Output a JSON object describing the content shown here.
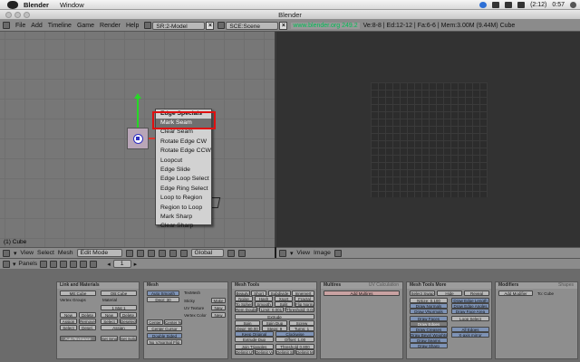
{
  "mac_menubar": {
    "app_name": "Blender",
    "menu": [
      "Window"
    ],
    "battery": "(2:12)",
    "clock": "0:57"
  },
  "window": {
    "title": "Blender"
  },
  "info_header": {
    "menus": [
      "File",
      "Add",
      "Timeline",
      "Game",
      "Render",
      "Help"
    ],
    "screen": "SR:2-Model",
    "scene": "SCE:Scene",
    "url": "www.blender.org 249.2",
    "stats": "Ve:8-8 | Ed:12-12 | Fa:6-6 | Mem:3.00M (9.44M) Cube"
  },
  "viewport_3d": {
    "object_label": "(1) Cube",
    "header": {
      "menus": [
        "View",
        "Select",
        "Mesh"
      ],
      "mode": "Edit Mode",
      "orientation": "Global"
    }
  },
  "edge_menu": {
    "title": "Edge Specials",
    "items": [
      "Mark Seam",
      "Clear Seam",
      "Rotate Edge CW",
      "Rotate Edge CCW",
      "Loopcut",
      "Edge Slide",
      "Edge Loop Select",
      "Edge Ring Select",
      "Loop to Region",
      "Region to Loop",
      "Mark Sharp",
      "Clear Sharp"
    ],
    "highlighted": "Mark Seam"
  },
  "image_editor": {
    "header": {
      "menus": [
        "View",
        "Image"
      ]
    }
  },
  "buttons_window": {
    "header_label": "Panels",
    "frame": "1",
    "panels": {
      "link_materials": {
        "title": "Link and Materials",
        "me": "ME:Cube",
        "ob": "OB:Cube",
        "vertex_groups": "Vertex Groups",
        "material": "Material",
        "mat_index": "1 Mat 1",
        "buttons": [
          "New",
          "Delete",
          "New",
          "Delete",
          "Assign",
          "Remove",
          "Select",
          "Deselect",
          "Select",
          "Desel.",
          "Assign",
          "AutoTexSpace",
          "Set Smooth",
          "Set Solid"
        ]
      },
      "mesh": {
        "title": "Mesh",
        "buttons": [
          "Auto Smooth",
          "Degr: 30",
          "TexMesh",
          "Sticky",
          "Make",
          "UV Texture",
          "New",
          "Vertex Color",
          "New",
          "Center",
          "Center New",
          "Center Cursor",
          "Double Sided",
          "No V.Normal Flip"
        ]
      },
      "mesh_tools": {
        "title": "Mesh Tools",
        "buttons": [
          "Beauty",
          "Short",
          "Subdivide",
          "Innervert",
          "Noise",
          "Hash",
          "Xsort",
          "Fractal",
          "To Sphere",
          "Smooth",
          "Split",
          "Flip Normals",
          "Rem Doubles",
          "Limit: 0.001",
          "Threshold: 0.010",
          "Extrude",
          "Spin",
          "Spin Dup",
          "Screw",
          "Degr: 90.00",
          "Steps: 9",
          "Turns: 1",
          "Keep Original",
          "Clockwise",
          "Extrude Dup",
          "Offset: 1.00",
          "Join Triangles",
          "Threshold 0.800",
          "Delimit UVs",
          "Delimit Vcol",
          "Delimit Sharp",
          "Delimit Mat"
        ]
      },
      "multires": {
        "title": "Multires",
        "tab": "UV Calculation",
        "button": "Add Multires"
      },
      "mesh_tools_more": {
        "title": "Mesh Tools More",
        "buttons": [
          "Select Swap",
          "Hide",
          "Reveal",
          "NSize: 0.100",
          "Draw Normals",
          "Draw Edge Length",
          "Draw VNormals",
          "Draw Edge Angles",
          "Draw Face Area",
          "Draw Faces",
          "Draw Edges",
          "Draw Creases",
          "Draw Bevel Weights",
          "Draw Seams",
          "Draw Sharp",
          "Loop Select",
          "All Edges",
          "X-axis mirror"
        ]
      },
      "modifiers": {
        "title": "Modifiers",
        "tab": "Shapes",
        "button": "Add Modifier",
        "target": "To: Cube"
      }
    }
  },
  "colors": {
    "viewport_bg": "#777777",
    "menu_bg": "#d2d2d2",
    "highlight": "#6f6f6f",
    "annotation_box": "#e01010",
    "header_bg": "#8b8b8b",
    "url_text": "#00bb55"
  }
}
